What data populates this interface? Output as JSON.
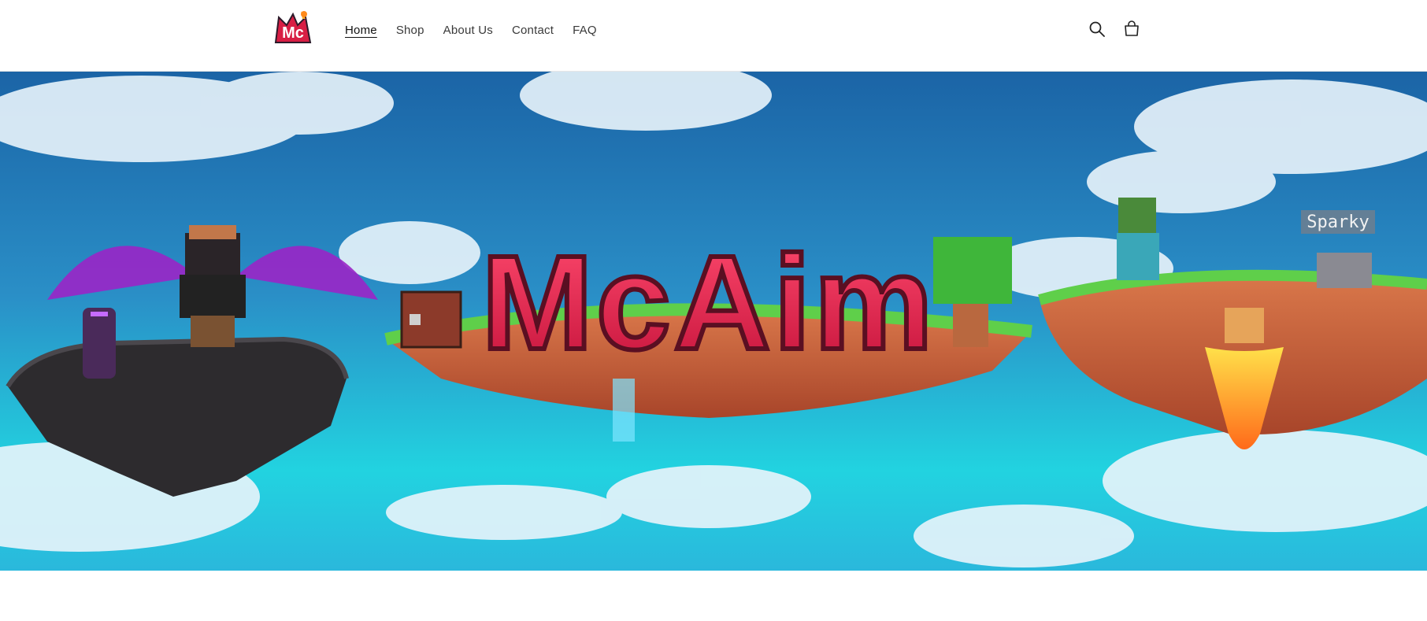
{
  "brand": {
    "logo_text": "Mc"
  },
  "nav": {
    "items": [
      {
        "label": "Home",
        "active": true
      },
      {
        "label": "Shop",
        "active": false
      },
      {
        "label": "About Us",
        "active": false
      },
      {
        "label": "Contact",
        "active": false
      },
      {
        "label": "FAQ",
        "active": false
      }
    ]
  },
  "header_icons": {
    "search": "search-icon",
    "cart": "cart-icon"
  },
  "hero": {
    "title": "McAim",
    "sign_text": "Sparky"
  },
  "colors": {
    "sky_top": "#1d6fae",
    "sky_bottom": "#22d6e0",
    "title_red": "#e0264a",
    "grass": "#5fcf4a"
  }
}
